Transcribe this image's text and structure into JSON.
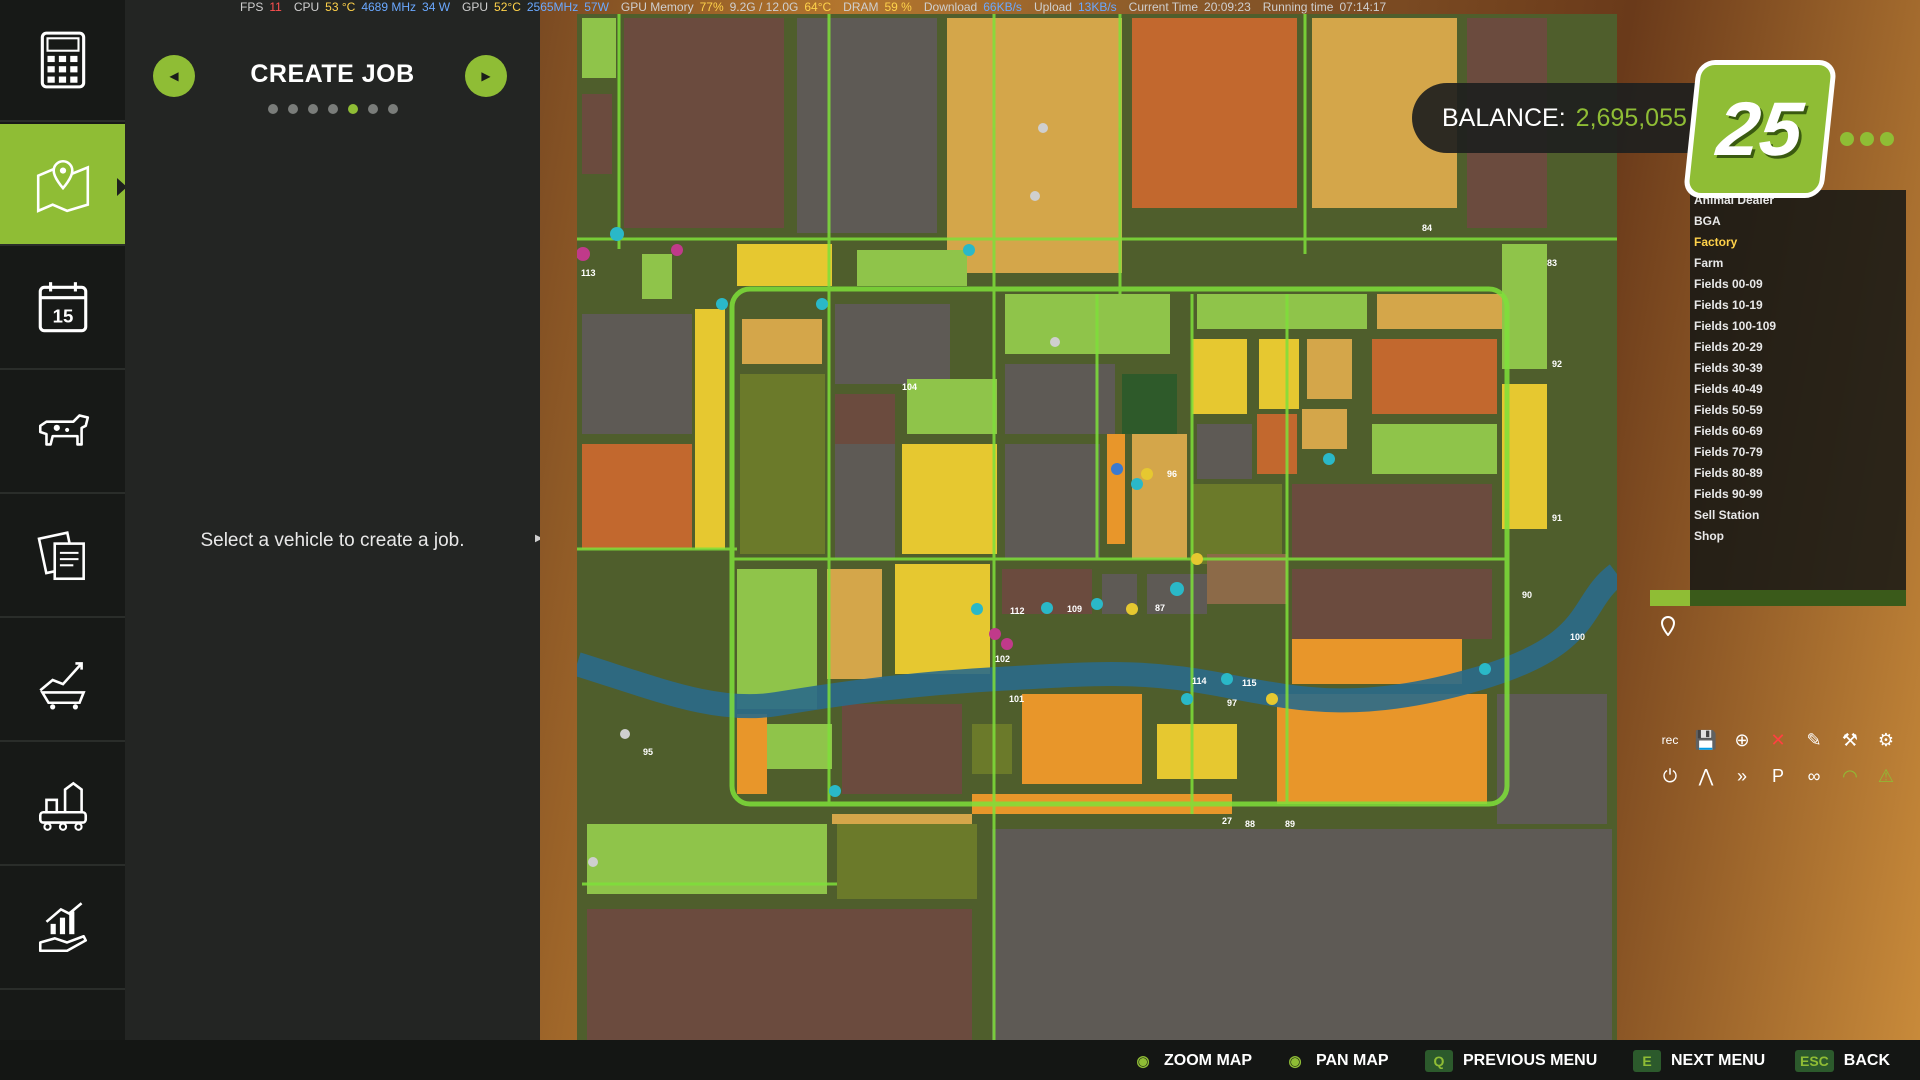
{
  "stats": {
    "fps_label": "FPS",
    "fps": "11",
    "cpu_label": "CPU",
    "cpu_temp": "53 °C",
    "cpu_freq": "4689 MHz",
    "cpu_power": "34 W",
    "gpu_label": "GPU",
    "gpu_temp": "52°C",
    "gpu_freq": "2565MHz",
    "gpu_power": "57W",
    "gpu_mem_label": "GPU Memory",
    "gpu_mem_pct": "77%",
    "gpu_mem_used": "9.2G / 12.0G",
    "gpu_mem_temp": "64°C",
    "dram_label": "DRAM",
    "dram_pct": "59 %",
    "download_label": "Download",
    "download": "66KB/s",
    "upload_label": "Upload",
    "upload": "13KB/s",
    "current_time_label": "Current Time",
    "current_time": "20:09:23",
    "running_time_label": "Running time",
    "running_time": "07:14:17"
  },
  "sidebar": {
    "items": [
      {
        "name": "calculator",
        "icon": "calculator-icon"
      },
      {
        "name": "map",
        "icon": "map-pin-icon",
        "active": true
      },
      {
        "name": "calendar",
        "icon": "calendar-icon",
        "day": "15"
      },
      {
        "name": "animals",
        "icon": "cow-icon"
      },
      {
        "name": "contracts",
        "icon": "documents-icon"
      },
      {
        "name": "prices",
        "icon": "chart-cart-icon"
      },
      {
        "name": "production",
        "icon": "factory-icon"
      },
      {
        "name": "finances",
        "icon": "hand-growth-icon"
      }
    ]
  },
  "panel": {
    "title": "CREATE JOB",
    "prev_glyph": "◀",
    "next_glyph": "▶",
    "page_count": 7,
    "page_active": 5,
    "hint": "Select a vehicle to create a job."
  },
  "balance": {
    "label": "BALANCE:",
    "value": "2,695,055"
  },
  "logo": {
    "text": "25"
  },
  "map_list": {
    "items": [
      {
        "label": "Animal Dealer",
        "highlight": false
      },
      {
        "label": "BGA",
        "highlight": false
      },
      {
        "label": "Factory",
        "highlight": true
      },
      {
        "label": "Farm",
        "highlight": false
      },
      {
        "label": "Fields 00-09",
        "highlight": false
      },
      {
        "label": "Fields 10-19",
        "highlight": false
      },
      {
        "label": "Fields 100-109",
        "highlight": false
      },
      {
        "label": "Fields 20-29",
        "highlight": false
      },
      {
        "label": "Fields 30-39",
        "highlight": false
      },
      {
        "label": "Fields 40-49",
        "highlight": false
      },
      {
        "label": "Fields 50-59",
        "highlight": false
      },
      {
        "label": "Fields 60-69",
        "highlight": false
      },
      {
        "label": "Fields 70-79",
        "highlight": false
      },
      {
        "label": "Fields 80-89",
        "highlight": false
      },
      {
        "label": "Fields 90-99",
        "highlight": false
      },
      {
        "label": "Sell Station",
        "highlight": false
      },
      {
        "label": "Shop",
        "highlight": false
      }
    ]
  },
  "toolbar": {
    "tools": [
      {
        "name": "record-icon",
        "glyph": "rec"
      },
      {
        "name": "save-icon",
        "glyph": "💾"
      },
      {
        "name": "add-marker-icon",
        "glyph": "⊕"
      },
      {
        "name": "remove-marker-icon",
        "glyph": "✕"
      },
      {
        "name": "edit-marker-icon",
        "glyph": "✎"
      },
      {
        "name": "harvester-icon",
        "glyph": "⚒"
      },
      {
        "name": "settings-icon",
        "glyph": "⚙"
      },
      {
        "name": "power-icon",
        "glyph": "⏻"
      },
      {
        "name": "road-icon",
        "glyph": "⋀"
      },
      {
        "name": "fast-forward-icon",
        "glyph": "»"
      },
      {
        "name": "parking-icon",
        "glyph": "P"
      },
      {
        "name": "loop-icon",
        "glyph": "∞"
      },
      {
        "name": "gauge-icon",
        "glyph": "◠"
      },
      {
        "name": "warning-icon",
        "glyph": "⚠"
      }
    ]
  },
  "map_labels": [
    {
      "label": "113"
    },
    {
      "label": "84"
    },
    {
      "label": "83"
    },
    {
      "label": "92"
    },
    {
      "label": "104"
    },
    {
      "label": "96"
    },
    {
      "label": "91"
    },
    {
      "label": "90"
    },
    {
      "label": "100"
    },
    {
      "label": "109"
    },
    {
      "label": "112"
    },
    {
      "label": "87"
    },
    {
      "label": "102"
    },
    {
      "label": "101"
    },
    {
      "label": "114"
    },
    {
      "label": "115"
    },
    {
      "label": "97"
    },
    {
      "label": "95"
    },
    {
      "label": "88"
    },
    {
      "label": "89"
    },
    {
      "label": "27"
    }
  ],
  "bottom_bar": {
    "zoom_label": "ZOOM MAP",
    "pan_label": "PAN MAP",
    "prev_key": "Q",
    "prev_label": "PREVIOUS MENU",
    "next_key": "E",
    "next_label": "NEXT MENU",
    "back_key": "ESC",
    "back_label": "BACK"
  },
  "colors": {
    "accent": "#8fbd35",
    "field_brown": "#6b4b3e",
    "field_orange": "#e8962a",
    "field_yellow": "#e6c830",
    "field_lightgreen": "#8fc44a",
    "field_olive": "#6b7a2a",
    "water": "#2a6a8a"
  }
}
